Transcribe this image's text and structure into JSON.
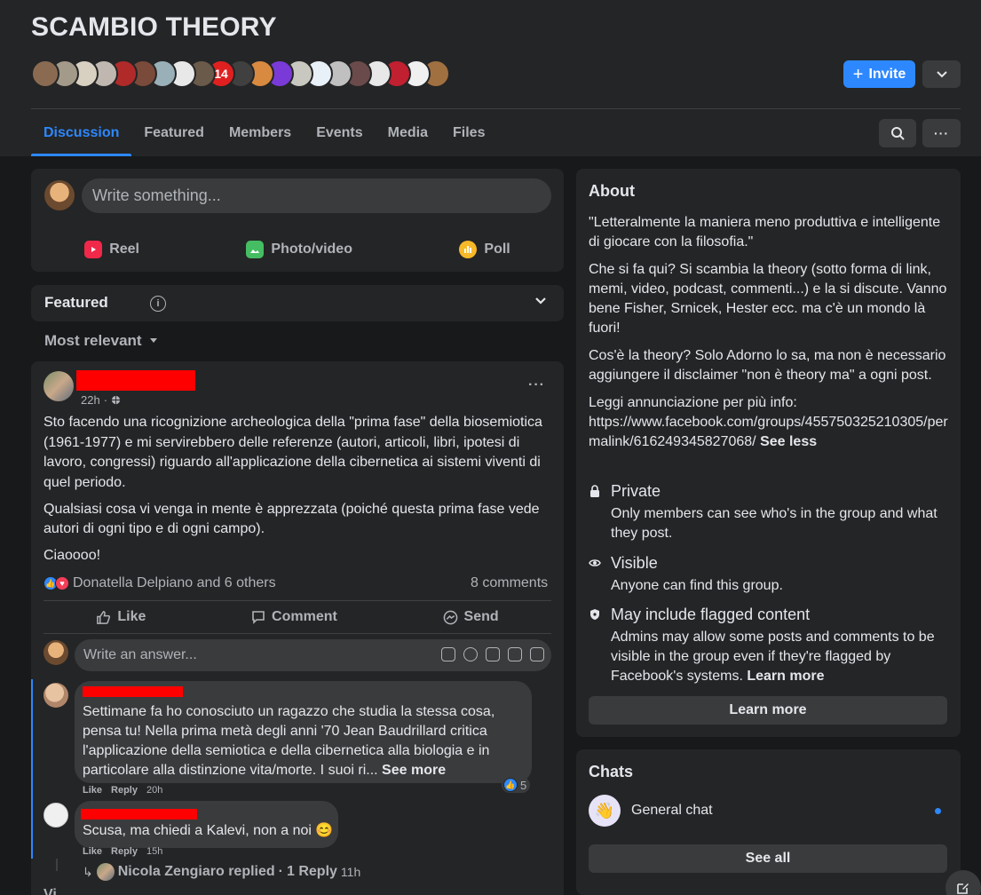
{
  "group": {
    "title": "SCAMBIO THEORY",
    "invite_label": "Invite",
    "invite_plus": "+",
    "member_avatar_colors": [
      "#8a6b52",
      "#a39a8a",
      "#d8d0c0",
      "#c0b8b0",
      "#b02a2a",
      "#7a4a3a",
      "#9ab0b8",
      "#e8e8e8",
      "#6a5a4a",
      "#e02020",
      "#404040",
      "#d88a40",
      "#7a3ad8",
      "#c8c8c0",
      "#e8f0f8",
      "#c0c0c0",
      "#6a4a4a",
      "#e8e8e8",
      "#c02030",
      "#f0f0f0",
      "#a07040"
    ],
    "member_badge": "14"
  },
  "tabs": [
    {
      "label": "Discussion",
      "active": true
    },
    {
      "label": "Featured",
      "active": false
    },
    {
      "label": "Members",
      "active": false
    },
    {
      "label": "Events",
      "active": false
    },
    {
      "label": "Media",
      "active": false
    },
    {
      "label": "Files",
      "active": false
    }
  ],
  "composer": {
    "placeholder": "Write something...",
    "actions": {
      "reel": "Reel",
      "photo": "Photo/video",
      "poll": "Poll"
    }
  },
  "featured": {
    "title": "Featured"
  },
  "sort": {
    "label": "Most relevant"
  },
  "post": {
    "time": "22h",
    "dot": "·",
    "dots": "···",
    "paragraphs": [
      "Sto facendo una ricognizione archeologica della \"prima fase\" della biosemiotica (1961-1977) e mi servirebbero delle referenze (autori, articoli, libri, ipotesi di lavoro, congressi) riguardo all'applicazione della cibernetica ai sistemi viventi di quel periodo.",
      "Qualsiasi cosa vi venga in mente è apprezzata (poiché questa prima fase vede autori di ogni tipo e di ogni campo).",
      "Ciaoooo!"
    ],
    "reactions_text": "Donatella Delpiano and 6 others",
    "comments_count": "8 comments",
    "actions": {
      "like": "Like",
      "comment": "Comment",
      "send": "Send"
    },
    "answer_placeholder": "Write an answer..."
  },
  "comments": [
    {
      "text": "Settimane fa ho conosciuto un ragazzo che studia la stessa cosa, pensa tu! Nella prima metà degli anni '70 Jean Baudrillard critica l'applicazione della semiotica e della cibernetica alla biologia e in particolare alla distinzione vita/morte. I suoi ri...",
      "see_more": "See more",
      "like": "Like",
      "reply": "Reply",
      "time": "20h",
      "like_count": "5"
    },
    {
      "text": "Scusa, ma chiedi a Kalevi, non a noi 😊",
      "like": "Like",
      "reply": "Reply",
      "time": "15h"
    }
  ],
  "replied": {
    "arrow": "↳",
    "name": "Nicola Zengiaro replied",
    "dot": "·",
    "count": "1 Reply",
    "time": "11h"
  },
  "view_more": "Vi",
  "about": {
    "title": "About",
    "desc": [
      "\"Letteralmente la maniera meno produttiva e intelligente di giocare con la filosofia.\"",
      "Che si fa qui? Si scambia la theory (sotto forma di link, memi, video, podcast, commenti...) e la si discute. Vanno bene Fisher, Srnicek, Hester ecc. ma c'è un mondo là fuori!",
      "Cos'è la theory? Solo Adorno lo sa, ma non è necessario aggiungere il disclaimer \"non è theory ma\" a ogni post."
    ],
    "link_intro": "Leggi annunciazione per più info:",
    "link": "https://www.facebook.com/groups/455750325210305/permalink/616249345827068/",
    "see_less": "See less",
    "private_title": "Private",
    "private_sub": "Only members can see who's in the group and what they post.",
    "visible_title": "Visible",
    "visible_sub": "Anyone can find this group.",
    "flagged_title": "May include flagged content",
    "flagged_sub": "Admins may allow some posts and comments to be visible in the group even if they're flagged by Facebook's systems.",
    "flagged_link": "Learn more",
    "learn_more_btn": "Learn more"
  },
  "chats": {
    "title": "Chats",
    "item": "General chat",
    "see_all": "See all"
  },
  "colors": {
    "accent": "#2d88ff",
    "bg": "#18191a",
    "card": "#242526",
    "redaction": "#ff0000"
  }
}
